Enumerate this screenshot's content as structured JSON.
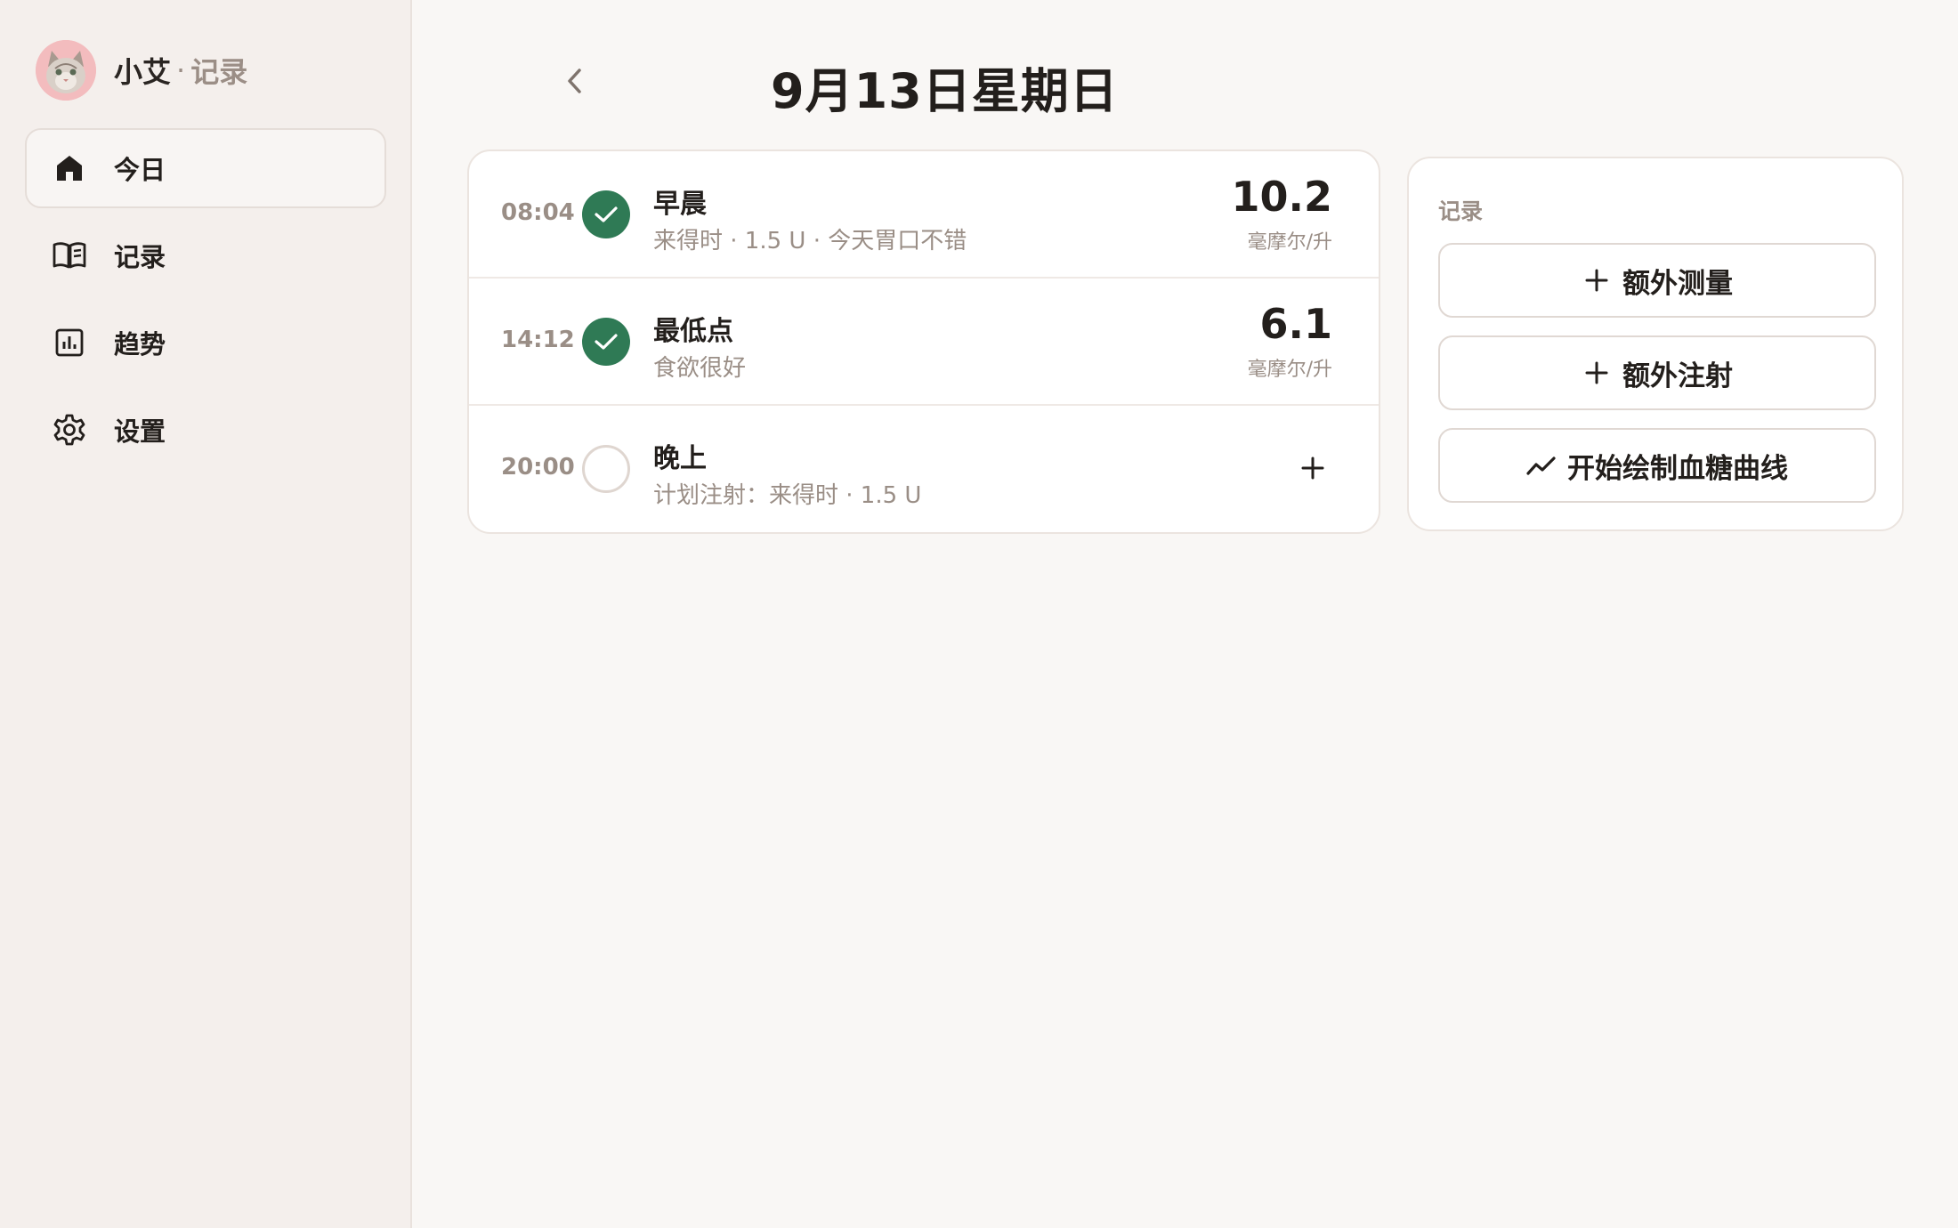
{
  "brand": {
    "name": "小艾",
    "separator": "·",
    "subtitle": "记录"
  },
  "sidebar": {
    "items": [
      {
        "label": "今日",
        "icon": "home-icon",
        "active": true
      },
      {
        "label": "记录",
        "icon": "book-icon",
        "active": false
      },
      {
        "label": "趋势",
        "icon": "chart-icon",
        "active": false
      },
      {
        "label": "设置",
        "icon": "gear-icon",
        "active": false
      }
    ]
  },
  "header": {
    "title": "9月13日星期日"
  },
  "entries": [
    {
      "time": "08:04",
      "status": "done",
      "title": "早晨",
      "subtitle": "来得时 · 1.5 U · 今天胃口不错",
      "value": "10.2",
      "unit": "毫摩尔/升"
    },
    {
      "time": "14:12",
      "status": "done",
      "title": "最低点",
      "subtitle": "食欲很好",
      "value": "6.1",
      "unit": "毫摩尔/升"
    },
    {
      "time": "20:00",
      "status": "pending",
      "title": "晚上",
      "subtitle": "计划注射：来得时 · 1.5 U"
    }
  ],
  "record_panel": {
    "title": "记录",
    "actions": [
      {
        "label": "额外测量",
        "icon": "plus-icon"
      },
      {
        "label": "额外注射",
        "icon": "plus-icon"
      },
      {
        "label": "开始绘制血糖曲线",
        "icon": "trend-icon"
      }
    ]
  },
  "colors": {
    "accent_green": "#2f7a55",
    "background": "#f9f7f5",
    "sidebar": "#f4efec",
    "muted_text": "#9a8e86"
  }
}
